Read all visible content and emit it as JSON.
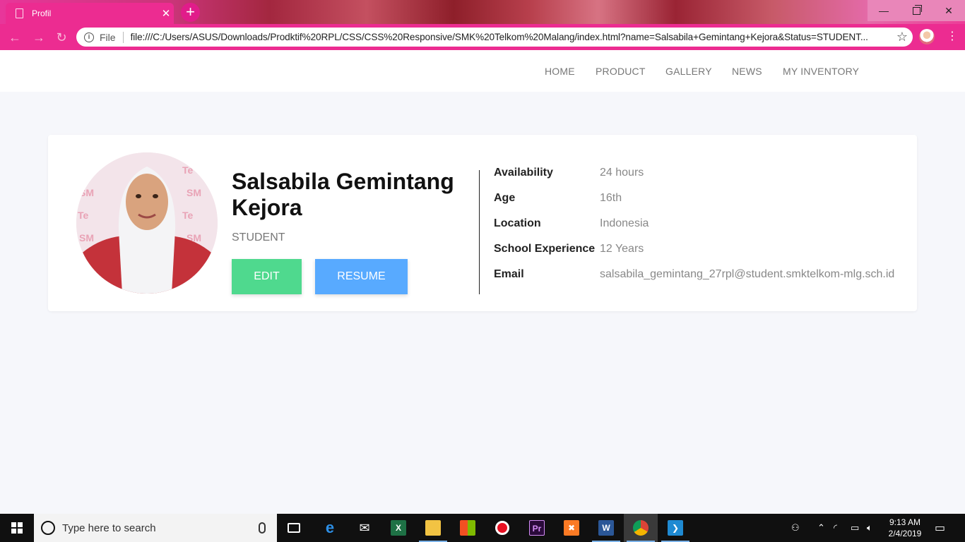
{
  "browser": {
    "tab_title": "Profil",
    "url_scheme": "File",
    "url": "file:///C:/Users/ASUS/Downloads/Prodktif%20RPL/CSS/CSS%20Responsive/SMK%20Telkom%20Malang/index.html?name=Salsabila+Gemintang+Kejora&Status=STUDENT..."
  },
  "nav": {
    "items": [
      "HOME",
      "PRODUCT",
      "GALLERY",
      "NEWS",
      "MY INVENTORY"
    ]
  },
  "profile": {
    "name": "Salsabila Gemintang Kejora",
    "role": "STUDENT",
    "edit_label": "EDIT",
    "resume_label": "RESUME",
    "details": [
      {
        "label": "Availability",
        "value": "24 hours"
      },
      {
        "label": "Age",
        "value": "16th"
      },
      {
        "label": "Location",
        "value": "Indonesia"
      },
      {
        "label": "School Experience",
        "value": "12 Years"
      },
      {
        "label": "Email",
        "value": "salsabila_gemintang_27rpl@student.smktelkom-mlg.sch.id"
      }
    ]
  },
  "taskbar": {
    "search_placeholder": "Type here to search",
    "time": "9:13 AM",
    "date": "2/4/2019"
  },
  "colors": {
    "browser_accent": "#ec2c91",
    "edit_button": "#4fd98e",
    "resume_button": "#58aaff"
  }
}
